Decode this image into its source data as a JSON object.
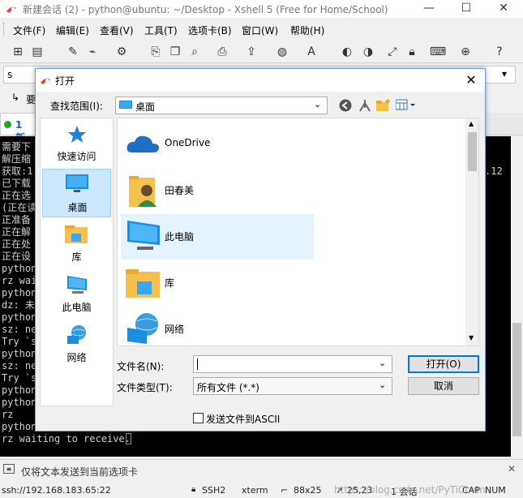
{
  "window": {
    "title": "新建会话 (2) - python@ubuntu: ~/Desktop - Xshell 5 (Free for Home/School)",
    "min_symbol": "—",
    "max_symbol": "☐",
    "close_symbol": "✕"
  },
  "menu": [
    "文件(F)",
    "编辑(E)",
    "查看(V)",
    "工具(T)",
    "选项卡(B)",
    "窗口(W)",
    "帮助(H)"
  ],
  "address_bar": {
    "prefix": "s",
    "dropdown_symbol": "▾"
  },
  "link_bar": {
    "text": "要"
  },
  "tab": {
    "label": "1 新"
  },
  "terminal": {
    "lines": [
      "需要下",
      "解压缩",
      "获取:1",
      "已下载",
      "正在选",
      "(正在读",
      "正准备",
      "正在解",
      "正在处",
      "正在设",
      "python",
      "rz wai",
      "python",
      "dz: 未",
      "python",
      "sz: ne",
      "Try `s",
      "python",
      "sz: ne",
      "Try `s",
      "python",
      "python",
      "rz",
      "python",
      "rz waiting to receive."
    ],
    "right_fragment": ".12"
  },
  "compose": {
    "text": "仅将文本发送到当前选项卡"
  },
  "status": {
    "connection": "ssh://192.168.183.65:22",
    "protocol": "SSH2",
    "term": "xterm",
    "size": "88x25",
    "cursor": "25,23",
    "sessions": "1 会话",
    "caps": "CAP",
    "num": "NUM",
    "watermark": "https://blog.csdn.net/PyTiCcvm"
  },
  "dialog": {
    "title": "打开",
    "look_in_label": "查找范围(I):",
    "look_in_value": "桌面",
    "places": [
      {
        "label": "快速访问",
        "icon": "star-icon"
      },
      {
        "label": "桌面",
        "icon": "desktop-icon"
      },
      {
        "label": "库",
        "icon": "library-folder-icon"
      },
      {
        "label": "此电脑",
        "icon": "computer-icon"
      },
      {
        "label": "网络",
        "icon": "network-icon"
      }
    ],
    "files": [
      {
        "name": "OneDrive",
        "icon": "cloud-icon"
      },
      {
        "name": "田春美",
        "icon": "user-folder-icon"
      },
      {
        "name": "此电脑",
        "icon": "computer-icon"
      },
      {
        "name": "库",
        "icon": "library-folder-icon"
      },
      {
        "name": "网络",
        "icon": "network-icon"
      }
    ],
    "filename_label": "文件名(N):",
    "filename_value": "",
    "filetype_label": "文件类型(T):",
    "filetype_value": "所有文件 (*.*)",
    "open_button": "打开(O)",
    "cancel_button": "取消",
    "ascii_checkbox_label": "发送文件到ASCII"
  },
  "colors": {
    "accent": "#0078d7",
    "terminal_bg": "#000000",
    "selection": "#cce8ff"
  }
}
